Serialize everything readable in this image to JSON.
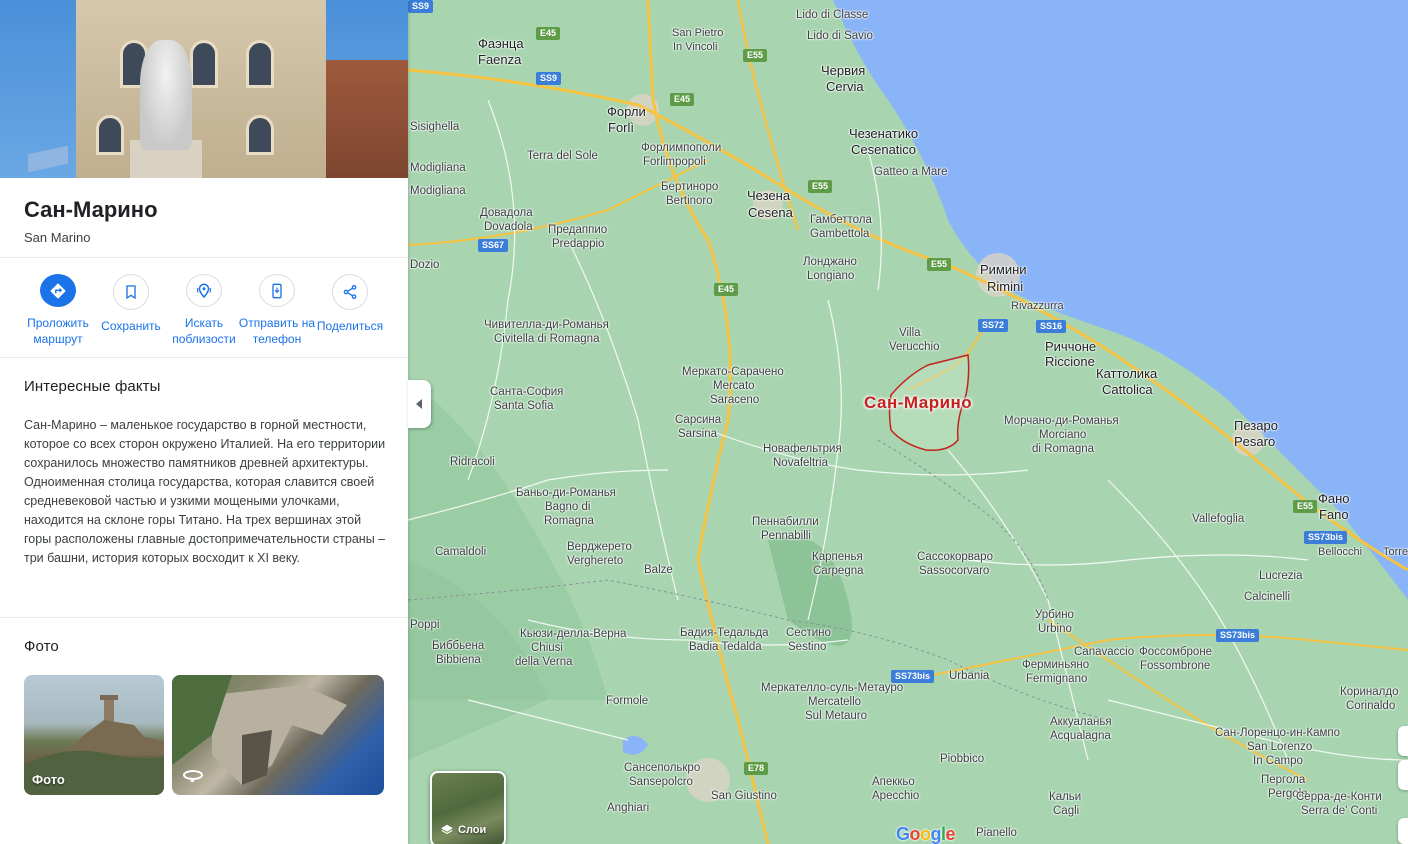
{
  "place": {
    "title": "Сан-Марино",
    "subtitle": "San Marino"
  },
  "actions": [
    {
      "label": "Проложить маршрут",
      "icon": "directions-icon"
    },
    {
      "label": "Сохранить",
      "icon": "bookmark-icon"
    },
    {
      "label": "Искать поблизости",
      "icon": "nearby-icon"
    },
    {
      "label": "Отправить на телефон",
      "icon": "send-to-phone-icon"
    },
    {
      "label": "Поделиться",
      "icon": "share-icon"
    }
  ],
  "facts": {
    "heading": "Интересные факты",
    "text": "Сан-Марино – маленькое государство в горной местности, которое со всех сторон окружено Италией. На его территории сохранилось множество памятников древней архитектуры. Одноименная столица государства, которая славится своей средневековой частью и узкими мощеными улочками, находится на склоне горы Титано. На трех вершинах этой горы расположены главные достопримечательности страны – три башни, история которых восходит к XI веку."
  },
  "photos": {
    "heading": "Фото",
    "items": [
      {
        "caption": "Фото"
      },
      {
        "caption": ""
      }
    ]
  },
  "map": {
    "highlight_label": "Сан-Марино",
    "layers_label": "Слои",
    "google_logo": "Google",
    "colors": {
      "land": "#a8d5b0",
      "sea": "#8ab4f8",
      "highway": "#f6c343",
      "border": "#c5221f"
    },
    "cities": [
      "Lido di Classe",
      "Lido di Savio",
      "Фаэнца",
      "Faenza",
      "San Pietro",
      "In Vincoli",
      "Червия",
      "Cervia",
      "Форли",
      "Forlì",
      "Форлимпополи",
      "Forlimpopoli",
      "Terra del Sole",
      "Чезенатико",
      "Cesenatico",
      "Gatteo a Mare",
      "Бертиноро",
      "Bertinoro",
      "Чезена",
      "Cesena",
      "Гамбеттола",
      "Gambettola",
      "Довадола",
      "Dovadola",
      "Предаппио",
      "Predappio",
      "Лонджано",
      "Longiano",
      "Римини",
      "Rimini",
      "Rivazzurra",
      "Риччоне",
      "Riccione",
      "Чивителла-ди-Романья",
      "Civitella di Romagna",
      "Villa",
      "Verucchio",
      "Каттолика",
      "Cattolica",
      "Меркато-Сарачено",
      "Mercato",
      "Saraceno",
      "Санта-София",
      "Santa Sofia",
      "Морчано-ди-Романья",
      "Morciano",
      "di Romagna",
      "Пезаро",
      "Pesaro",
      "Сарсина",
      "Sarsina",
      "Новафельтрия",
      "Novafeltria",
      "Ridracoli",
      "Баньо-ди-Романья",
      "Bagno di",
      "Romagna",
      "Пеннабилли",
      "Pennabilli",
      "Фано",
      "Fano",
      "Vallefoglia",
      "Верджерето",
      "Verghereto",
      "Карпенья",
      "Carpegna",
      "Bellocchi",
      "Torrette",
      "Сассокорваро",
      "Sassocorvaro",
      "Balze",
      "Lucrezia",
      "Camaldoli",
      "Calcinelli",
      "Урбино",
      "Urbino",
      "Кьюзи-делла-Верна",
      "Chiusi",
      "della Verna",
      "Бадия-Тедальда",
      "Badia Tedalda",
      "Сестино",
      "Sestino",
      "Canavaccio",
      "Фоссомброне",
      "Fossombrone",
      "Биббьена",
      "Bibbiena",
      "Poppi",
      "Ферминьяно",
      "Fermignano",
      "Urbania",
      "Меркателло-суль-Метауро",
      "Mercatello",
      "Sul Metauro",
      "Кориналдо",
      "Corinaldo",
      "Formole",
      "Аккуаланья",
      "Acqualagna",
      "Сан-Лоренцо-ин-Кампо",
      "San Lorenzo",
      "In Campo",
      "Сансеполькро",
      "Sansepolcro",
      "San Giustino",
      "Piobbico",
      "Апеккьо",
      "Apecchio",
      "Перголa",
      "Pergola",
      "Anghiari",
      "Кальи",
      "Cagli",
      "Серра-де-Конти",
      "Serra de' Conti",
      "Pianello",
      "Modigliana",
      "Modigliana",
      "Sisighella",
      "Dozio"
    ],
    "road_shields": [
      {
        "label": "SS9",
        "type": "blue"
      },
      {
        "label": "E45",
        "type": "green"
      },
      {
        "label": "E55",
        "type": "green"
      },
      {
        "label": "SS67",
        "type": "blue"
      },
      {
        "label": "SS72",
        "type": "blue"
      },
      {
        "label": "SS16",
        "type": "blue"
      },
      {
        "label": "SS73bis",
        "type": "blue"
      },
      {
        "label": "E78",
        "type": "green"
      }
    ]
  }
}
